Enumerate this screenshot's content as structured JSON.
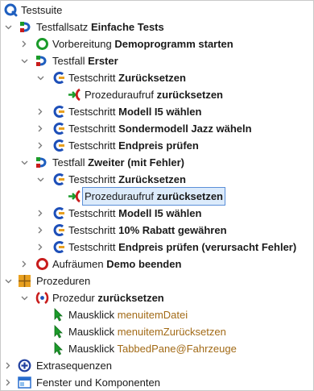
{
  "tree": {
    "root": {
      "label": "Testsuite"
    },
    "testset": {
      "prefix": "Testfallsatz",
      "name": "Einfache Tests"
    },
    "prep": {
      "prefix": "Vorbereitung",
      "name": "Demoprogramm starten"
    },
    "case1": {
      "prefix": "Testfall",
      "name": "Erster"
    },
    "case1_step1": {
      "prefix": "Testschritt",
      "name": "Zurücksetzen"
    },
    "case1_call": {
      "prefix": "Prozeduraufruf",
      "name": "zurücksetzen"
    },
    "case1_step2": {
      "prefix": "Testschritt",
      "name": "Modell I5 wählen"
    },
    "case1_step3": {
      "prefix": "Testschritt",
      "name": "Sondermodell Jazz wäheln"
    },
    "case1_step4": {
      "prefix": "Testschritt",
      "name": "Endpreis prüfen"
    },
    "case2": {
      "prefix": "Testfall",
      "name": "Zweiter (mit Fehler)"
    },
    "case2_step1": {
      "prefix": "Testschritt",
      "name": "Zurücksetzen"
    },
    "case2_call": {
      "prefix": "Prozeduraufruf",
      "name": "zurücksetzen"
    },
    "case2_step2": {
      "prefix": "Testschritt",
      "name": "Modell I5 wählen"
    },
    "case2_step3": {
      "prefix": "Testschritt",
      "name": "10% Rabatt gewähren"
    },
    "case2_step4": {
      "prefix": "Testschritt",
      "name": "Endpreis prüfen (verursacht Fehler)"
    },
    "cleanup": {
      "prefix": "Aufräumen",
      "name": "Demo beenden"
    },
    "procs": {
      "label": "Prozeduren"
    },
    "proc": {
      "prefix": "Prozedur",
      "name": "zurücksetzen"
    },
    "click1": {
      "prefix": "Mausklick",
      "target": "menuitemDatei"
    },
    "click2": {
      "prefix": "Mausklick",
      "target": "menuitemZurücksetzen"
    },
    "click3": {
      "prefix": "Mausklick",
      "target": "TabbedPane@Fahrzeuge"
    },
    "extras": {
      "label": "Extrasequenzen"
    },
    "windows": {
      "label": "Fenster und Komponenten"
    }
  },
  "colors": {
    "suite_blue": "#1f5fbf",
    "step_blue": "#1d4fb8",
    "green": "#1b9b2a",
    "red": "#c81c1c",
    "orange": "#e8a020",
    "param_text": "#a26a16",
    "selection_bg": "#dcebfb",
    "selection_border": "#5b8fd8"
  },
  "selected_node": "case2_call"
}
